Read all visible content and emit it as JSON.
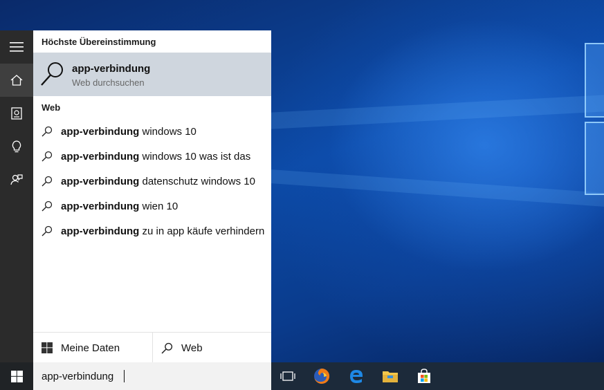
{
  "best_match": {
    "heading": "Höchste Übereinstimmung",
    "title": "app-verbindung",
    "subtitle": "Web durchsuchen"
  },
  "web": {
    "heading": "Web",
    "suggestions": [
      {
        "bold": "app-verbindung",
        "rest": " windows 10"
      },
      {
        "bold": "app-verbindung",
        "rest": " windows 10 was ist das"
      },
      {
        "bold": "app-verbindung",
        "rest": " datenschutz windows 10"
      },
      {
        "bold": "app-verbindung",
        "rest": " wien 10"
      },
      {
        "bold": "app-verbindung",
        "rest": " zu in app käufe verhindern"
      }
    ]
  },
  "scopes": {
    "my_data": "Meine Daten",
    "web": "Web"
  },
  "search": {
    "value": "app-verbindung"
  },
  "sidebar": {
    "items": [
      "menu-icon",
      "home-icon",
      "notebook-icon",
      "lightbulb-icon",
      "feedback-icon"
    ]
  },
  "taskbar": {
    "apps": [
      "task-view-icon",
      "firefox-icon",
      "edge-icon",
      "file-explorer-icon",
      "store-icon"
    ]
  },
  "colors": {
    "accent_selected": "#cfd6de",
    "sidebar": "#2b2b2b",
    "taskbar": "#1c2a3a"
  }
}
